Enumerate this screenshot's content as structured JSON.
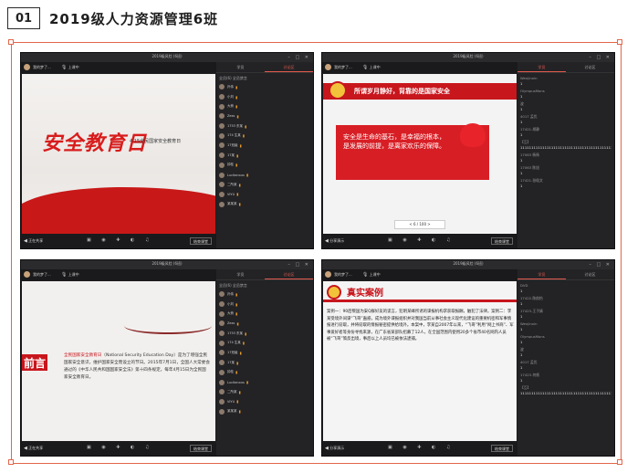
{
  "header": {
    "index": "01",
    "title": "2019级人力资源管理6班"
  },
  "windows": [
    {
      "id": "w1",
      "window_title": "2019级风险 (6班)",
      "user": "我的梦了...",
      "mic": "上课中",
      "slide": {
        "title": "安全教育日",
        "subtitle": "4·15全民国家安全教育日"
      },
      "bottom_left": "正在共享",
      "end_button": "结束课堂",
      "panel": {
        "tabs": [
          "学员",
          "讨论区"
        ],
        "active_tab": 1,
        "top": "全员(6)  全员禁言",
        "members": [
          "孙伟",
          "小刘",
          "大熊",
          "Zexs",
          "1753 东某",
          "174 生某",
          "17班级",
          "17某",
          "钟桂",
          "Lucitanxus",
          "二所某",
          "VIYU",
          "某某某"
        ]
      }
    },
    {
      "id": "w2",
      "window_title": "2019级风险 (6班)",
      "user": "我的梦了...",
      "mic": "上课中",
      "slide": {
        "title": "所谓岁月静好，背靠的是国家安全",
        "body": "安全是生命的基石，是幸福的根本，是发展的前提，是离家欢乐的保障。",
        "pager": "< 6 / 100 >"
      },
      "bottom_left": "分享演示",
      "end_button": "结束课堂",
      "panel": {
        "tabs": [
          "学员",
          "讨论区"
        ],
        "active_tab": 0,
        "chat": [
          {
            "name": "Wenjinxin",
            "msg": "1"
          },
          {
            "name": "OlympusMons",
            "msg": "1"
          },
          {
            "name": "波",
            "msg": "1"
          },
          {
            "name": "4017  孟优",
            "msg": "1"
          },
          {
            "name": "17421-胡静",
            "msg": "1"
          },
          {
            "name": "【互】",
            "msg": "1111111111111111111111111111111111111111111"
          },
          {
            "name": "17063 杨杨",
            "msg": "1"
          },
          {
            "name": "17063 陈旭",
            "msg": "1"
          },
          {
            "name": "17421-张晗文",
            "msg": "1"
          }
        ]
      }
    },
    {
      "id": "w3",
      "window_title": "2019级风险 (6班)",
      "user": "我的梦了...",
      "mic": "上课中",
      "slide": {
        "band": "前言",
        "body_highlight": "全民国家安全教育日",
        "body": "（National Security Education Day）是为了增强全民国家安全意识，维护国家安全而设立的节日。2015年7月1日，全国人大常委会通过的《中华人民共和国国家安全法》第十四条规定，每年4月15日为全民国家安全教育日。"
      },
      "bottom_left": "正在共享",
      "end_button": "结束课堂",
      "panel": {
        "tabs": [
          "学员",
          "讨论区"
        ],
        "active_tab": 1,
        "top": "全员(6)  全员禁言",
        "members": [
          "孙伟",
          "小刘",
          "大熊",
          "Zexs",
          "1753 东某",
          "174 生某",
          "17班级",
          "17某",
          "钟桂",
          "Lucitanxus",
          "二所某",
          "VIYU",
          "某某某"
        ]
      }
    },
    {
      "id": "w4",
      "window_title": "2019级风险 (6班)",
      "user": "我的梦了...",
      "mic": "上课中",
      "slide": {
        "title": "真实案例",
        "body": "案例一：90后叛国为安Q群好友的谎言，犯明某峰所诱的谍报机构求获取报酬，触犯了法律。案例二：李某受境外间谍“飞哥”蛊惑，成为境外谍报组织并对我国当前从事社会主义现代化建设的重要机密和军事情报进行窃取，并将窃取的情报秘密提供给境外。本案中，李某自2007年以来，“飞哥”利用“网上书商”、军事爱好者等身份寻找来源，在广东省某部队招募了12人，在全国范围内使用20多个省市40名网内人员被“飞哥”策反出境，事后以上人员均已被依法逮捕。"
      },
      "bottom_left": "分享演示",
      "end_button": "结束课堂",
      "panel": {
        "tabs": [
          "学员",
          "讨论区"
        ],
        "active_tab": 0,
        "chat": [
          {
            "name": "DVD",
            "msg": "1"
          },
          {
            "name": "17422-陈韵怡",
            "msg": "1"
          },
          {
            "name": "17423-王子婧",
            "msg": "1"
          },
          {
            "name": "Wenjinxin",
            "msg": "1"
          },
          {
            "name": "OlympusMons",
            "msg": "1"
          },
          {
            "name": "波",
            "msg": "1"
          },
          {
            "name": "4017  孟优",
            "msg": "1"
          },
          {
            "name": "17423-何帆",
            "msg": "1"
          },
          {
            "name": "【互】",
            "msg": "1111111111111111111111111111111111111111111"
          }
        ]
      }
    }
  ]
}
